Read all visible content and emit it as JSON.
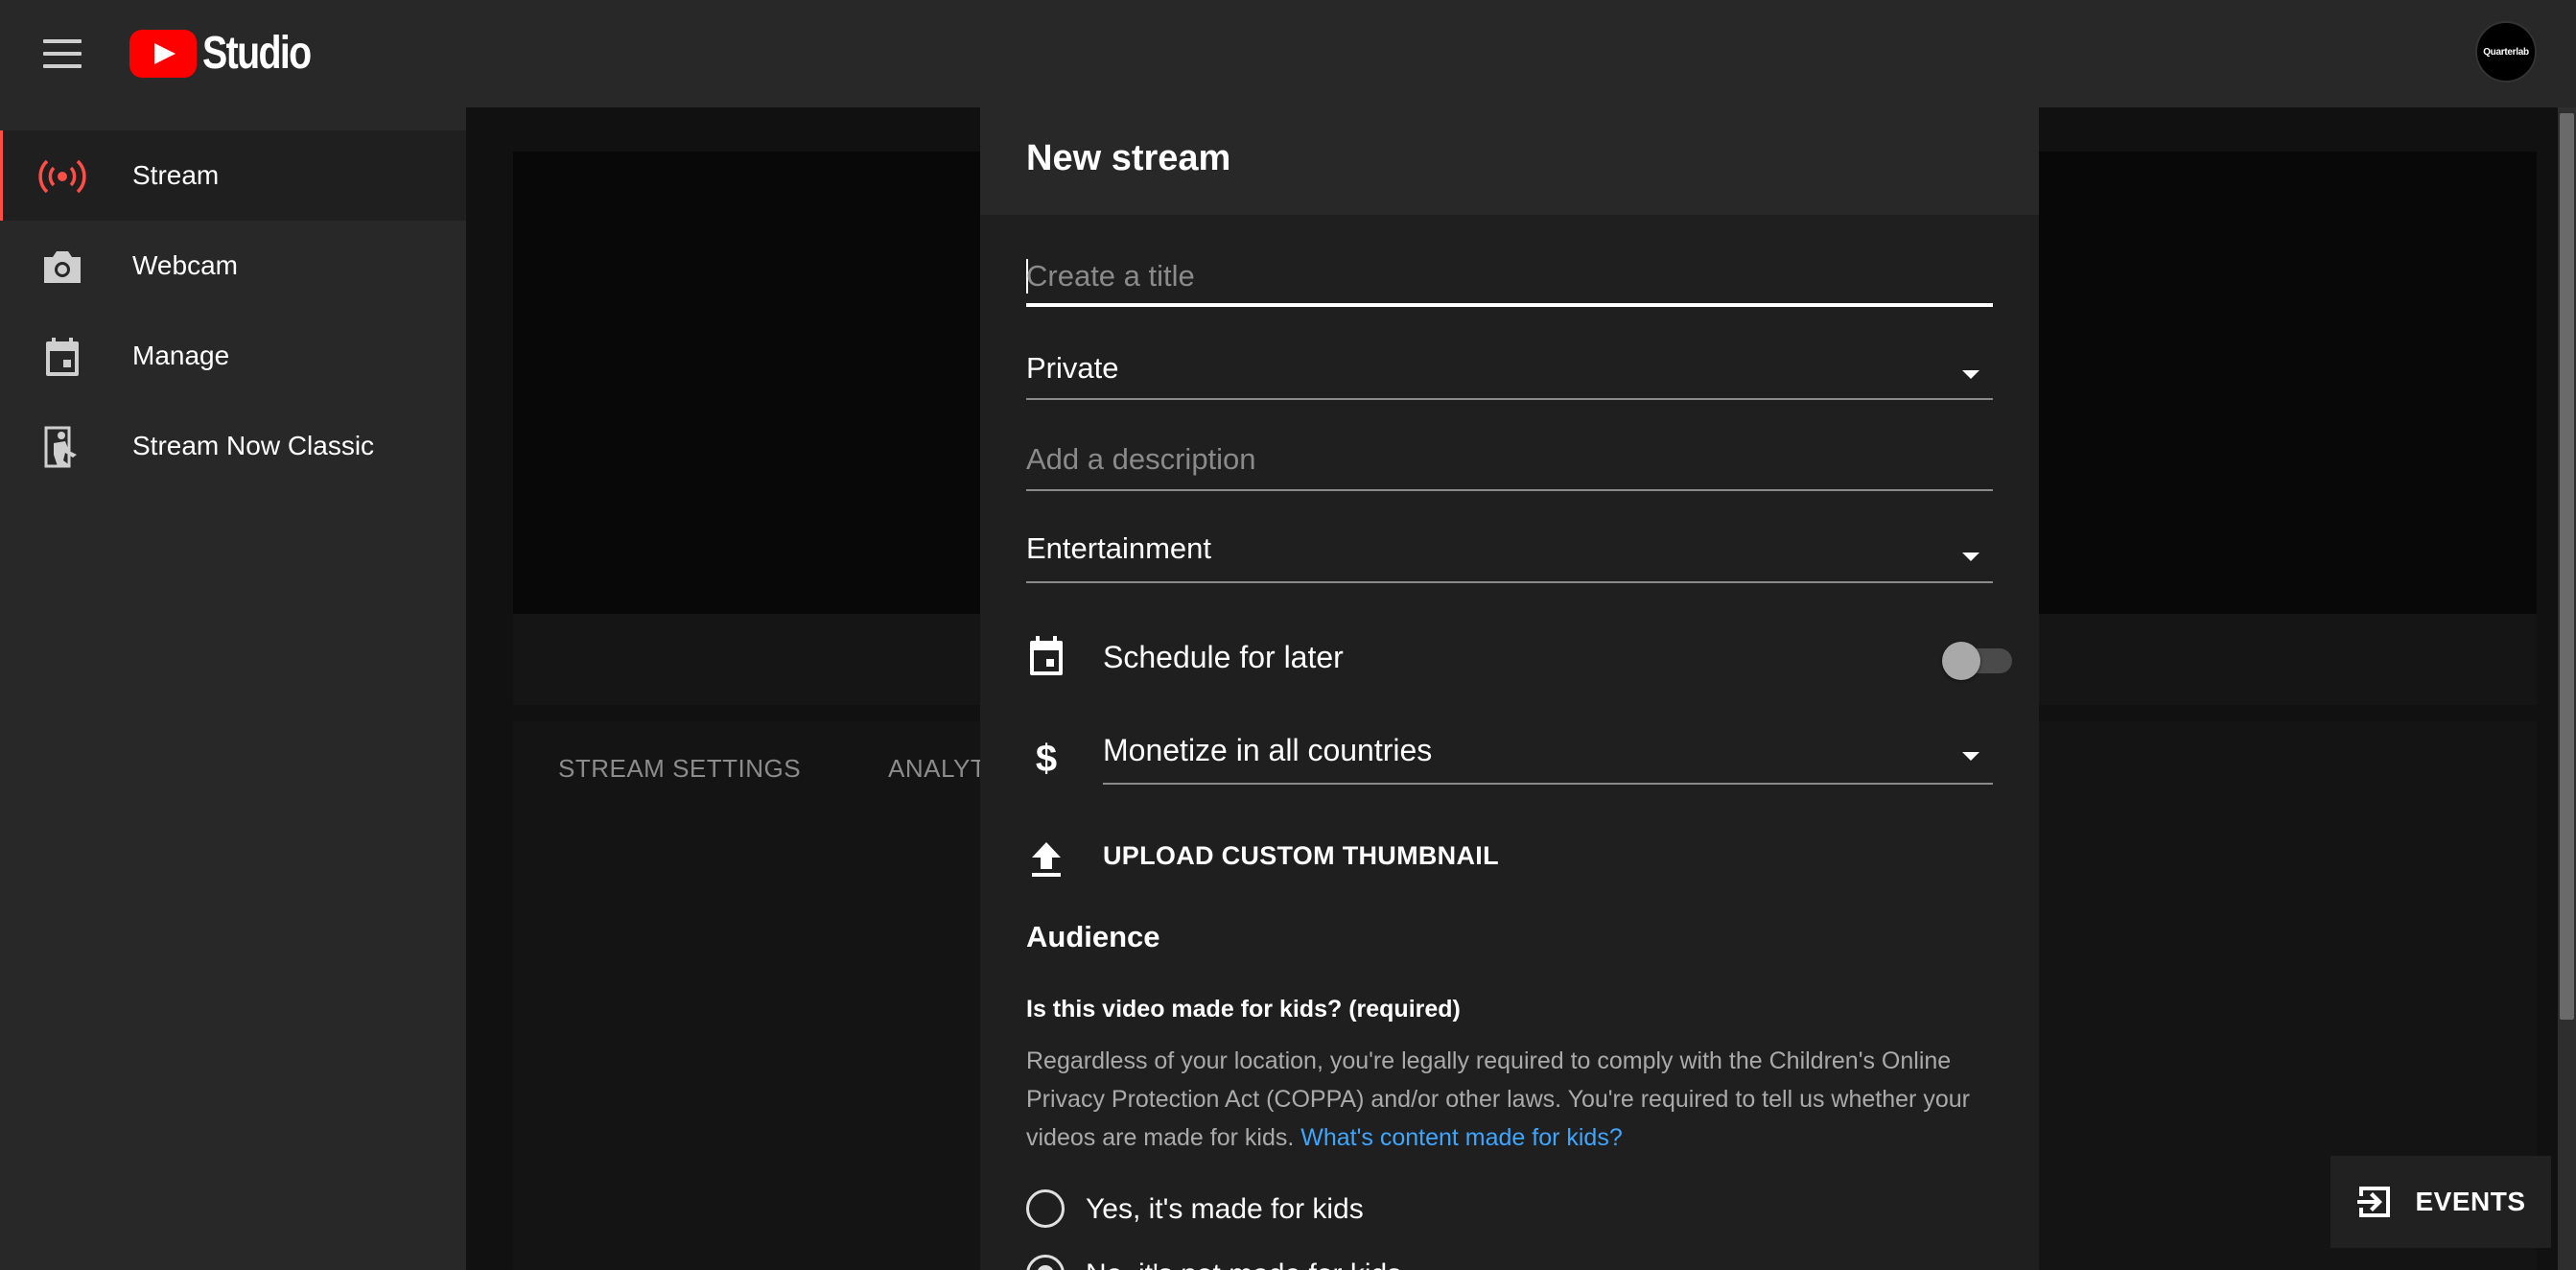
{
  "app": {
    "logo_text": "Studio",
    "avatar_text": "Quarterlab"
  },
  "sidebar": {
    "items": [
      {
        "label": "Stream",
        "icon": "live-broadcast-icon",
        "active": true
      },
      {
        "label": "Webcam",
        "icon": "camera-icon",
        "active": false
      },
      {
        "label": "Manage",
        "icon": "calendar-icon",
        "active": false
      },
      {
        "label": "Stream Now Classic",
        "icon": "classic-stream-icon",
        "active": false
      }
    ]
  },
  "background": {
    "tabs": [
      "STREAM SETTINGS",
      "ANALYT"
    ]
  },
  "dialog": {
    "title": "New stream",
    "title_placeholder": "Create a title",
    "visibility": "Private",
    "description_placeholder": "Add a description",
    "category": "Entertainment",
    "schedule_label": "Schedule for later",
    "schedule_enabled": false,
    "monetize": "Monetize in all countries",
    "upload_label": "UPLOAD CUSTOM THUMBNAIL",
    "audience": {
      "title": "Audience",
      "question": "Is this video made for kids? (required)",
      "description": "Regardless of your location, you're legally required to comply with the Children's Online Privacy Protection Act (COPPA) and/or other laws. You're required to tell us whether your videos are made for kids.",
      "link": "What's content made for kids?",
      "options": [
        {
          "label": "Yes, it's made for kids",
          "checked": false
        },
        {
          "label": "No, it's not made for kids",
          "checked": true
        }
      ]
    }
  },
  "events_button": "EVENTS",
  "colors": {
    "accent_red": "#ff4e45",
    "link_blue": "#3ea6ff",
    "background": "#1f1f1f"
  }
}
